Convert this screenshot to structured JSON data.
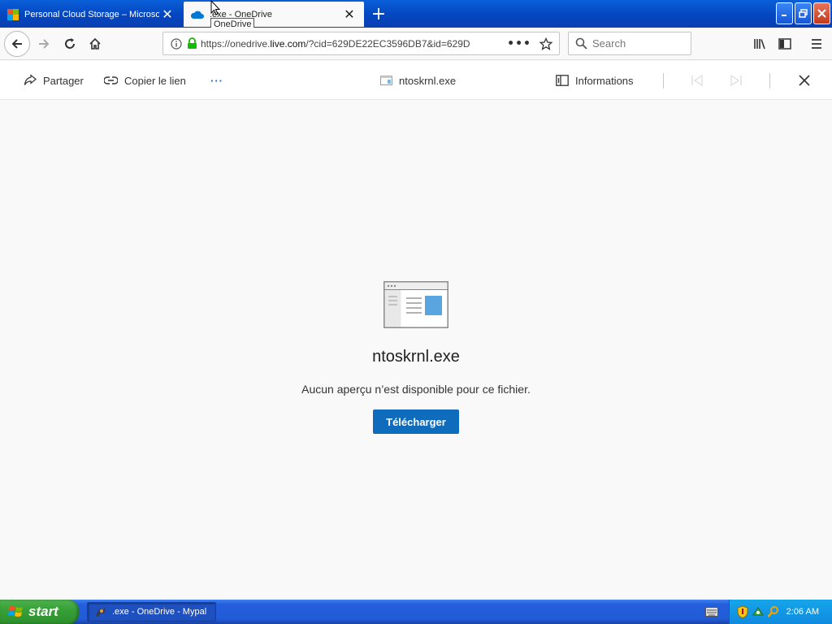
{
  "browser": {
    "tabs": [
      {
        "label": "Personal Cloud Storage – Microsof",
        "active": false
      },
      {
        "label": ".exe - OneDrive",
        "active": true
      }
    ],
    "tooltip": "OneDrive",
    "url": {
      "prefix": "https://onedrive.",
      "domain": "live.com",
      "suffix": "/?cid=629DE22EC3596DB7&id=629D"
    },
    "search_placeholder": "Search"
  },
  "viewer_toolbar": {
    "share_label": "Partager",
    "copy_link_label": "Copier le lien",
    "file_name": "ntoskrnl.exe",
    "info_label": "Informations"
  },
  "preview": {
    "file_name": "ntoskrnl.exe",
    "message": "Aucun aperçu n’est disponible pour ce fichier.",
    "download_label": "Télécharger"
  },
  "taskbar": {
    "start_label": "start",
    "task_label": ".exe - OneDrive - Mypal",
    "clock": "2:06 AM"
  },
  "colors": {
    "accent": "#0f6cbd",
    "onedrive_blue": "#0078d4",
    "xp_taskbar": "#245edb",
    "xp_start": "#37a137"
  }
}
